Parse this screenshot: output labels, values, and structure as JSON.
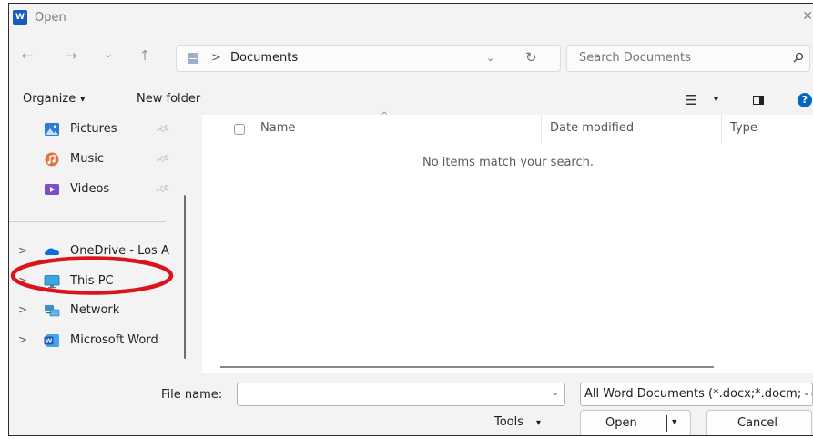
{
  "window": {
    "title": "Open",
    "app_icon_letter": "W"
  },
  "nav": {
    "back_glyph": "←",
    "forward_glyph": "→",
    "recent_glyph": "⌄",
    "up_glyph": "↑",
    "address": {
      "separator": ">",
      "location": "Documents",
      "chevron": "⌄",
      "refresh_glyph": "↻"
    },
    "search": {
      "placeholder": "Search Documents"
    }
  },
  "toolbar": {
    "organize": "Organize",
    "caret": "▾",
    "new_folder": "New folder",
    "help": "?"
  },
  "sidebar": {
    "items": [
      {
        "label": "Pictures",
        "icon": "pictures-icon",
        "color": "#2f7ad6",
        "pinned": true
      },
      {
        "label": "Music",
        "icon": "music-icon",
        "color": "#e4703a",
        "pinned": true
      },
      {
        "label": "Videos",
        "icon": "videos-icon",
        "color": "#7b4fc9",
        "pinned": true
      },
      {
        "label": "OneDrive - Los A",
        "icon": "onedrive-icon",
        "color": "#0a6fd6",
        "expand": ">"
      },
      {
        "label": "This PC",
        "icon": "monitor-icon",
        "color": "#3aa8e6",
        "expand": ">"
      },
      {
        "label": "Network",
        "icon": "network-icon",
        "color": "#3d8fd1",
        "expand": ">"
      },
      {
        "label": "Microsoft Word",
        "icon": "word-icon",
        "color": "#185abd",
        "expand": ">"
      }
    ]
  },
  "content": {
    "columns": [
      "Name",
      "Date modified",
      "Type"
    ],
    "sort_glyph": "^",
    "empty_message": "No items match your search."
  },
  "bottom": {
    "file_name_label": "File name:",
    "file_name_value": "",
    "filter_value": "All Word Documents (*.docx;*.docm;*.dotx;*.dotm;*.doc)",
    "chevron": "⌄",
    "tools_label": "Tools",
    "open_label": "Open",
    "cancel_label": "Cancel"
  },
  "annotation": {
    "color": "#d9141b"
  }
}
